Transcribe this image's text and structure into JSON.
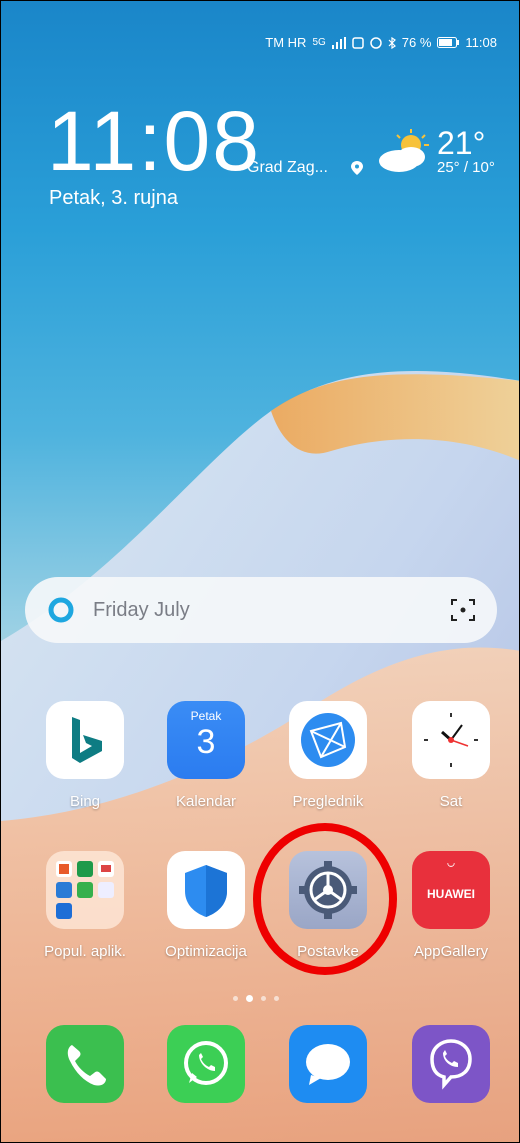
{
  "status": {
    "carrier": "TM HR",
    "network": "5G",
    "battery": "76 %",
    "time": "11:08"
  },
  "clock": {
    "time": "11:08",
    "city": "Grad Zag...",
    "date": "Petak, 3. rujna"
  },
  "weather": {
    "temp": "21°",
    "range": "25° / 10°",
    "icon": "partly-cloudy-icon"
  },
  "search": {
    "text": "Friday July",
    "icon": "search-icon",
    "scan": "scan-icon"
  },
  "apps_row1": [
    {
      "label": "Bing"
    },
    {
      "label": "Kalendar",
      "day": "Petak",
      "num": "3"
    },
    {
      "label": "Preglednik"
    },
    {
      "label": "Sat"
    }
  ],
  "apps_row2": [
    {
      "label": "Popul. aplik."
    },
    {
      "label": "Optimizacija"
    },
    {
      "label": "Postavke"
    },
    {
      "label": "AppGallery",
      "brand": "HUAWEI"
    }
  ],
  "dock": [
    "phone-icon",
    "whatsapp-icon",
    "messages-icon",
    "viber-icon"
  ],
  "colors": {
    "bing": "#0e7c83",
    "calendar": "#2b7cf0",
    "browser": "#2d8cf0",
    "shield": "#2d8cf0",
    "settings": "#4a5a78",
    "appgallery": "#e8303c",
    "phone": "#3bbf4f",
    "whatsapp": "#3ccf55",
    "messages": "#1e8cf2",
    "viber": "#7d55c7",
    "highlight": "#e00000"
  }
}
